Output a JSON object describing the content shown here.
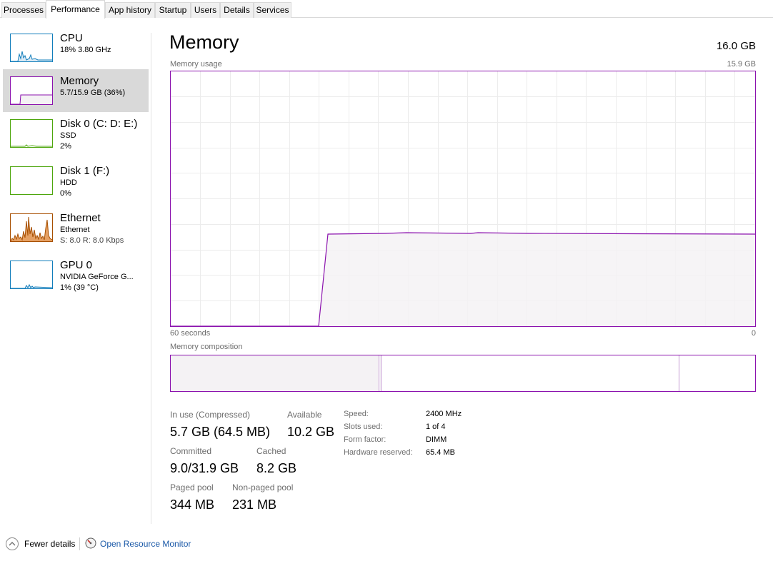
{
  "tabs": [
    {
      "label": "Processes"
    },
    {
      "label": "Performance",
      "active": true
    },
    {
      "label": "App history"
    },
    {
      "label": "Startup"
    },
    {
      "label": "Users"
    },
    {
      "label": "Details"
    },
    {
      "label": "Services"
    }
  ],
  "sidebar": {
    "items": [
      {
        "title": "CPU",
        "sub1": "18% 3.80 GHz",
        "sub2": "",
        "color": "#117dbb"
      },
      {
        "title": "Memory",
        "sub1": "5.7/15.9 GB (36%)",
        "sub2": "",
        "color": "#8b12ae",
        "selected": true
      },
      {
        "title": "Disk 0 (C: D: E:)",
        "sub1": "SSD",
        "sub2": "2%",
        "color": "#4da60c"
      },
      {
        "title": "Disk 1 (F:)",
        "sub1": "HDD",
        "sub2": "0%",
        "color": "#4da60c"
      },
      {
        "title": "Ethernet",
        "sub1": "Ethernet",
        "sub2": "S: 8.0  R: 8.0 Kbps",
        "color": "#a74f01"
      },
      {
        "title": "GPU 0",
        "sub1": "NVIDIA GeForce G...",
        "sub2": "1% (39 °C)",
        "color": "#117dbb"
      }
    ]
  },
  "main": {
    "title": "Memory",
    "total": "16.0 GB",
    "usage_label": "Memory usage",
    "usage_max": "15.9 GB",
    "time_left": "60 seconds",
    "time_right": "0",
    "composition_label": "Memory composition",
    "accent_color": "#8b12ae"
  },
  "stats": {
    "in_use_label": "In use (Compressed)",
    "in_use_value": "5.7 GB (64.5 MB)",
    "available_label": "Available",
    "available_value": "10.2 GB",
    "committed_label": "Committed",
    "committed_value": "9.0/31.9 GB",
    "cached_label": "Cached",
    "cached_value": "8.2 GB",
    "paged_label": "Paged pool",
    "paged_value": "344 MB",
    "nonpaged_label": "Non-paged pool",
    "nonpaged_value": "231 MB"
  },
  "details": [
    {
      "label": "Speed:",
      "value": "2400 MHz"
    },
    {
      "label": "Slots used:",
      "value": "1 of 4"
    },
    {
      "label": "Form factor:",
      "value": "DIMM"
    },
    {
      "label": "Hardware reserved:",
      "value": "65.4 MB"
    }
  ],
  "footer": {
    "fewer_details": "Fewer details",
    "open_resource_monitor": "Open Resource Monitor"
  }
}
